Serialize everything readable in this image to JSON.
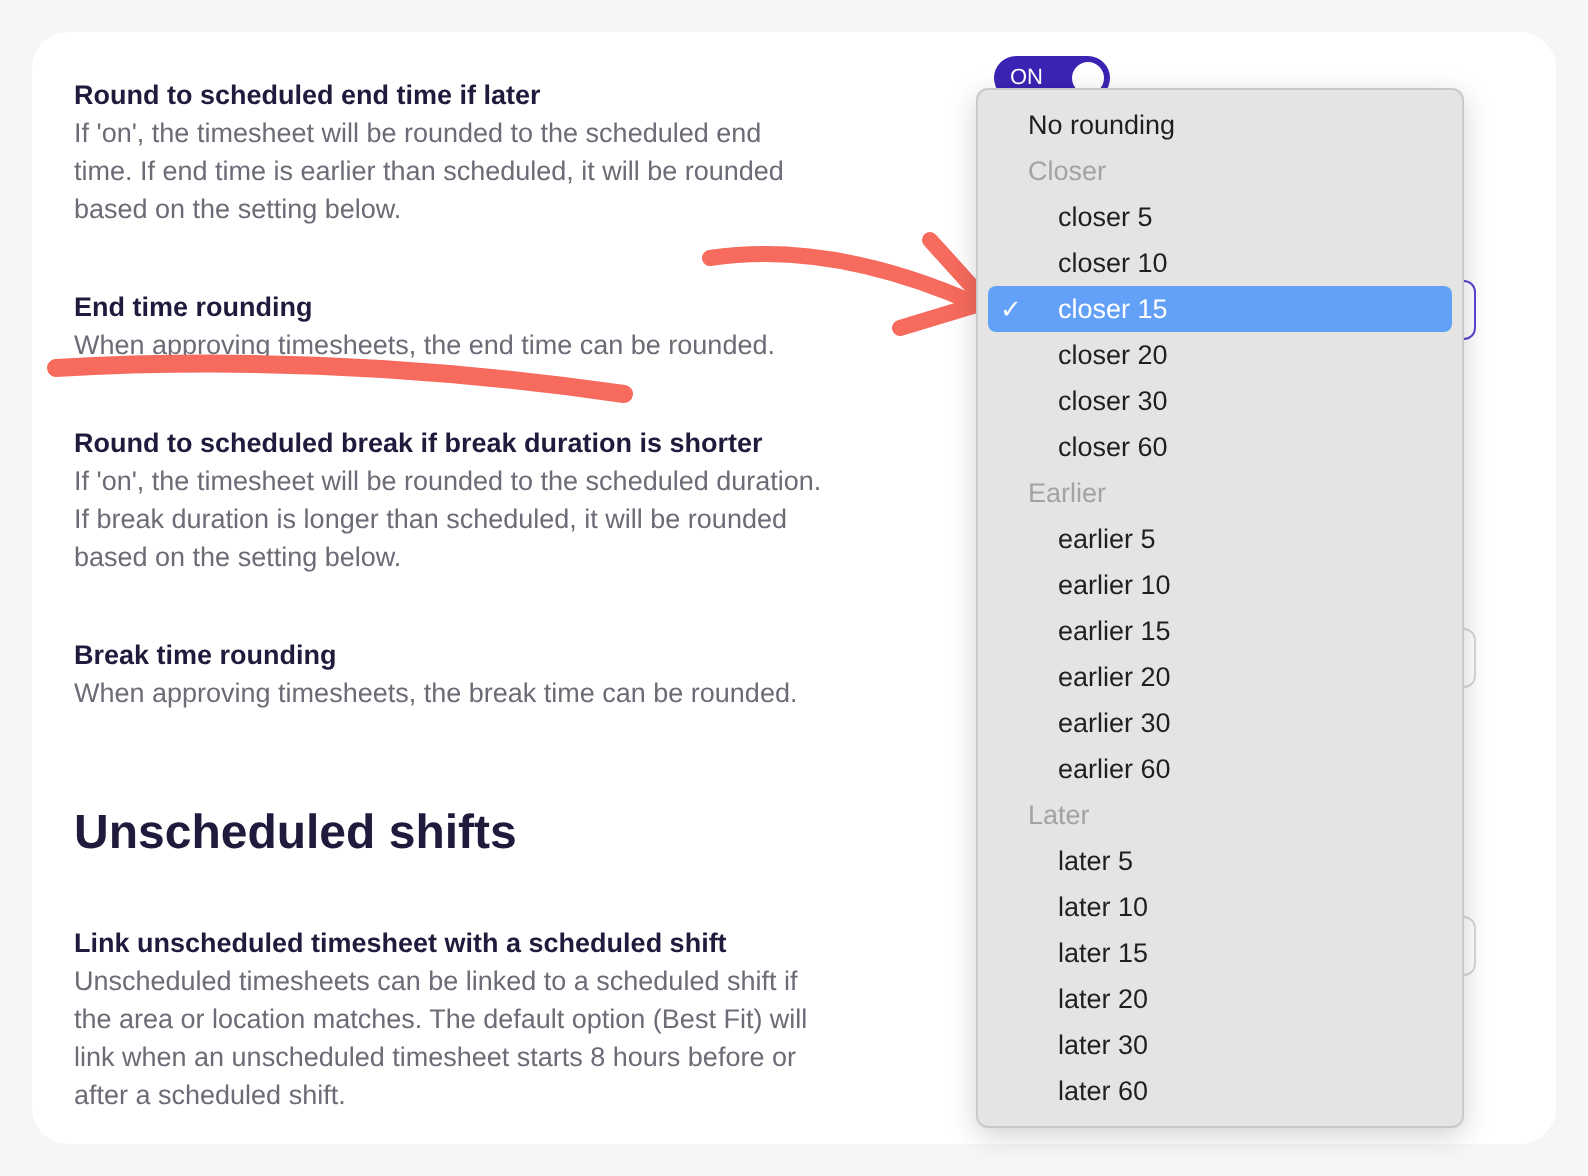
{
  "settings": [
    {
      "kind": "setting",
      "title": "Round to scheduled end time if later",
      "description": "If 'on', the timesheet will be rounded to the scheduled end time. If end time is earlier than scheduled, it will be rounded based on the setting below.",
      "control": {
        "kind": "toggle",
        "label": "ON",
        "on": true
      }
    },
    {
      "kind": "setting",
      "title": "End time rounding",
      "description": "When approving timesheets, the end time can be rounded.",
      "control": {
        "kind": "select",
        "focused": true
      }
    },
    {
      "kind": "setting",
      "title": "Round to scheduled break if break duration is shorter",
      "description": "If 'on', the timesheet will be rounded to the scheduled duration. If break duration is longer than scheduled, it will be rounded based on the setting below."
    },
    {
      "kind": "setting",
      "title": "Break time rounding",
      "description": "When approving timesheets, the break time can be rounded.",
      "control": {
        "kind": "select",
        "focused": false
      }
    },
    {
      "kind": "heading",
      "title": "Unscheduled shifts"
    },
    {
      "kind": "setting",
      "title": "Link unscheduled timesheet with a scheduled shift",
      "description": "Unscheduled timesheets can be linked to a scheduled shift if the area or location matches. The default option (Best Fit) will link when an unscheduled timesheet starts 8 hours before or after a scheduled shift.",
      "control": {
        "kind": "select",
        "focused": false
      }
    }
  ],
  "dropdown_menu": {
    "check_mark": "✓",
    "items": [
      {
        "kind": "option",
        "label": "No rounding",
        "selected": false
      },
      {
        "kind": "group",
        "label": "Closer",
        "options": [
          {
            "label": "closer 5",
            "selected": false
          },
          {
            "label": "closer 10",
            "selected": false
          },
          {
            "label": "closer 15",
            "selected": true
          },
          {
            "label": "closer 20",
            "selected": false
          },
          {
            "label": "closer 30",
            "selected": false
          },
          {
            "label": "closer 60",
            "selected": false
          }
        ]
      },
      {
        "kind": "group",
        "label": "Earlier",
        "options": [
          {
            "label": "earlier 5",
            "selected": false
          },
          {
            "label": "earlier 10",
            "selected": false
          },
          {
            "label": "earlier 15",
            "selected": false
          },
          {
            "label": "earlier 20",
            "selected": false
          },
          {
            "label": "earlier 30",
            "selected": false
          },
          {
            "label": "earlier 60",
            "selected": false
          }
        ]
      },
      {
        "kind": "group",
        "label": "Later",
        "options": [
          {
            "label": "later 5",
            "selected": false
          },
          {
            "label": "later 10",
            "selected": false
          },
          {
            "label": "later 15",
            "selected": false
          },
          {
            "label": "later 20",
            "selected": false
          },
          {
            "label": "later 30",
            "selected": false
          },
          {
            "label": "later 60",
            "selected": false
          }
        ]
      }
    ]
  }
}
